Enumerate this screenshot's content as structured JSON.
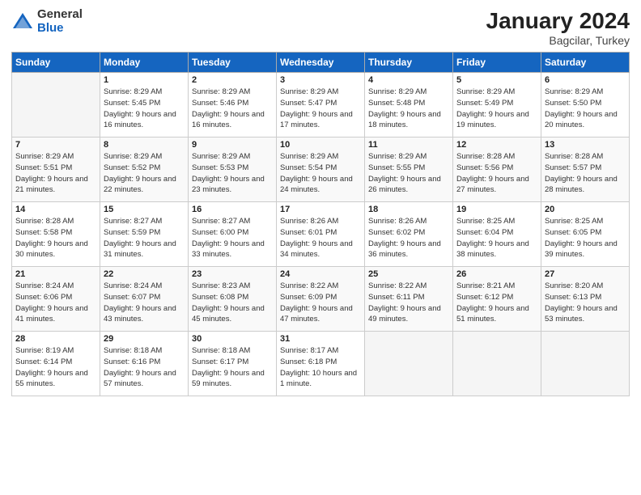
{
  "logo": {
    "general": "General",
    "blue": "Blue"
  },
  "header": {
    "month": "January 2024",
    "location": "Bagcilar, Turkey"
  },
  "weekdays": [
    "Sunday",
    "Monday",
    "Tuesday",
    "Wednesday",
    "Thursday",
    "Friday",
    "Saturday"
  ],
  "weeks": [
    [
      {
        "day": "",
        "empty": true
      },
      {
        "day": "1",
        "sunrise": "Sunrise: 8:29 AM",
        "sunset": "Sunset: 5:45 PM",
        "daylight": "Daylight: 9 hours and 16 minutes."
      },
      {
        "day": "2",
        "sunrise": "Sunrise: 8:29 AM",
        "sunset": "Sunset: 5:46 PM",
        "daylight": "Daylight: 9 hours and 16 minutes."
      },
      {
        "day": "3",
        "sunrise": "Sunrise: 8:29 AM",
        "sunset": "Sunset: 5:47 PM",
        "daylight": "Daylight: 9 hours and 17 minutes."
      },
      {
        "day": "4",
        "sunrise": "Sunrise: 8:29 AM",
        "sunset": "Sunset: 5:48 PM",
        "daylight": "Daylight: 9 hours and 18 minutes."
      },
      {
        "day": "5",
        "sunrise": "Sunrise: 8:29 AM",
        "sunset": "Sunset: 5:49 PM",
        "daylight": "Daylight: 9 hours and 19 minutes."
      },
      {
        "day": "6",
        "sunrise": "Sunrise: 8:29 AM",
        "sunset": "Sunset: 5:50 PM",
        "daylight": "Daylight: 9 hours and 20 minutes."
      }
    ],
    [
      {
        "day": "7",
        "sunrise": "Sunrise: 8:29 AM",
        "sunset": "Sunset: 5:51 PM",
        "daylight": "Daylight: 9 hours and 21 minutes."
      },
      {
        "day": "8",
        "sunrise": "Sunrise: 8:29 AM",
        "sunset": "Sunset: 5:52 PM",
        "daylight": "Daylight: 9 hours and 22 minutes."
      },
      {
        "day": "9",
        "sunrise": "Sunrise: 8:29 AM",
        "sunset": "Sunset: 5:53 PM",
        "daylight": "Daylight: 9 hours and 23 minutes."
      },
      {
        "day": "10",
        "sunrise": "Sunrise: 8:29 AM",
        "sunset": "Sunset: 5:54 PM",
        "daylight": "Daylight: 9 hours and 24 minutes."
      },
      {
        "day": "11",
        "sunrise": "Sunrise: 8:29 AM",
        "sunset": "Sunset: 5:55 PM",
        "daylight": "Daylight: 9 hours and 26 minutes."
      },
      {
        "day": "12",
        "sunrise": "Sunrise: 8:28 AM",
        "sunset": "Sunset: 5:56 PM",
        "daylight": "Daylight: 9 hours and 27 minutes."
      },
      {
        "day": "13",
        "sunrise": "Sunrise: 8:28 AM",
        "sunset": "Sunset: 5:57 PM",
        "daylight": "Daylight: 9 hours and 28 minutes."
      }
    ],
    [
      {
        "day": "14",
        "sunrise": "Sunrise: 8:28 AM",
        "sunset": "Sunset: 5:58 PM",
        "daylight": "Daylight: 9 hours and 30 minutes."
      },
      {
        "day": "15",
        "sunrise": "Sunrise: 8:27 AM",
        "sunset": "Sunset: 5:59 PM",
        "daylight": "Daylight: 9 hours and 31 minutes."
      },
      {
        "day": "16",
        "sunrise": "Sunrise: 8:27 AM",
        "sunset": "Sunset: 6:00 PM",
        "daylight": "Daylight: 9 hours and 33 minutes."
      },
      {
        "day": "17",
        "sunrise": "Sunrise: 8:26 AM",
        "sunset": "Sunset: 6:01 PM",
        "daylight": "Daylight: 9 hours and 34 minutes."
      },
      {
        "day": "18",
        "sunrise": "Sunrise: 8:26 AM",
        "sunset": "Sunset: 6:02 PM",
        "daylight": "Daylight: 9 hours and 36 minutes."
      },
      {
        "day": "19",
        "sunrise": "Sunrise: 8:25 AM",
        "sunset": "Sunset: 6:04 PM",
        "daylight": "Daylight: 9 hours and 38 minutes."
      },
      {
        "day": "20",
        "sunrise": "Sunrise: 8:25 AM",
        "sunset": "Sunset: 6:05 PM",
        "daylight": "Daylight: 9 hours and 39 minutes."
      }
    ],
    [
      {
        "day": "21",
        "sunrise": "Sunrise: 8:24 AM",
        "sunset": "Sunset: 6:06 PM",
        "daylight": "Daylight: 9 hours and 41 minutes."
      },
      {
        "day": "22",
        "sunrise": "Sunrise: 8:24 AM",
        "sunset": "Sunset: 6:07 PM",
        "daylight": "Daylight: 9 hours and 43 minutes."
      },
      {
        "day": "23",
        "sunrise": "Sunrise: 8:23 AM",
        "sunset": "Sunset: 6:08 PM",
        "daylight": "Daylight: 9 hours and 45 minutes."
      },
      {
        "day": "24",
        "sunrise": "Sunrise: 8:22 AM",
        "sunset": "Sunset: 6:09 PM",
        "daylight": "Daylight: 9 hours and 47 minutes."
      },
      {
        "day": "25",
        "sunrise": "Sunrise: 8:22 AM",
        "sunset": "Sunset: 6:11 PM",
        "daylight": "Daylight: 9 hours and 49 minutes."
      },
      {
        "day": "26",
        "sunrise": "Sunrise: 8:21 AM",
        "sunset": "Sunset: 6:12 PM",
        "daylight": "Daylight: 9 hours and 51 minutes."
      },
      {
        "day": "27",
        "sunrise": "Sunrise: 8:20 AM",
        "sunset": "Sunset: 6:13 PM",
        "daylight": "Daylight: 9 hours and 53 minutes."
      }
    ],
    [
      {
        "day": "28",
        "sunrise": "Sunrise: 8:19 AM",
        "sunset": "Sunset: 6:14 PM",
        "daylight": "Daylight: 9 hours and 55 minutes."
      },
      {
        "day": "29",
        "sunrise": "Sunrise: 8:18 AM",
        "sunset": "Sunset: 6:16 PM",
        "daylight": "Daylight: 9 hours and 57 minutes."
      },
      {
        "day": "30",
        "sunrise": "Sunrise: 8:18 AM",
        "sunset": "Sunset: 6:17 PM",
        "daylight": "Daylight: 9 hours and 59 minutes."
      },
      {
        "day": "31",
        "sunrise": "Sunrise: 8:17 AM",
        "sunset": "Sunset: 6:18 PM",
        "daylight": "Daylight: 10 hours and 1 minute."
      },
      {
        "day": "",
        "empty": true
      },
      {
        "day": "",
        "empty": true
      },
      {
        "day": "",
        "empty": true
      }
    ]
  ]
}
